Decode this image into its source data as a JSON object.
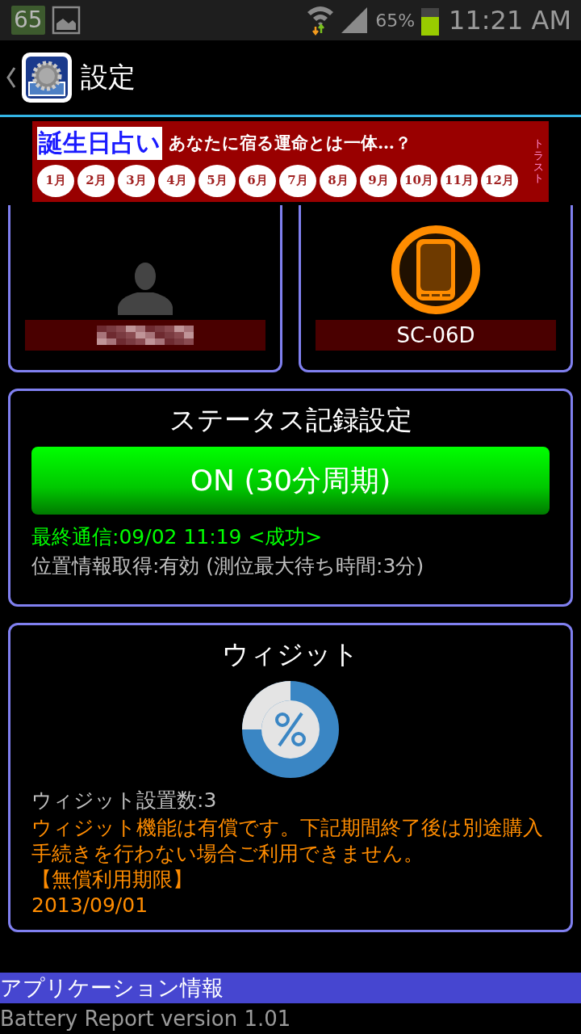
{
  "status_bar": {
    "notification_badge": "65",
    "battery_percent": "65%",
    "time": "11:21 AM"
  },
  "action_bar": {
    "title": "設定"
  },
  "banner": {
    "title": "誕生日占い",
    "tagline": "あなたに宿る運命とは一体…？",
    "months": [
      "1月",
      "2月",
      "3月",
      "4月",
      "5月",
      "6月",
      "7月",
      "8月",
      "9月",
      "10月",
      "11月",
      "12月"
    ],
    "brand": "トラスト"
  },
  "profile_cards": [
    {
      "kind": "user",
      "label_pixelated": true
    },
    {
      "kind": "device",
      "label": "SC-06D"
    }
  ],
  "status_record": {
    "title": "ステータス記録設定",
    "toggle": {
      "label": "ON (30分周期)",
      "on": true
    },
    "last_comm": "最終通信:09/02 11:19 <成功>",
    "location": "位置情報取得:有効 (測位最大待ち時間:3分)"
  },
  "widget": {
    "title": "ウィジット",
    "count": "ウィジット設置数:3",
    "notice": "ウィジット機能は有償です。下記期間終了後は別途購入手続きを行わない場合ご利用できません。",
    "period_label": "【無償利用期限】",
    "period_date": "2013/09/01"
  },
  "app_info": {
    "header": "アプリケーション情報",
    "version": "Battery Report version 1.01"
  }
}
